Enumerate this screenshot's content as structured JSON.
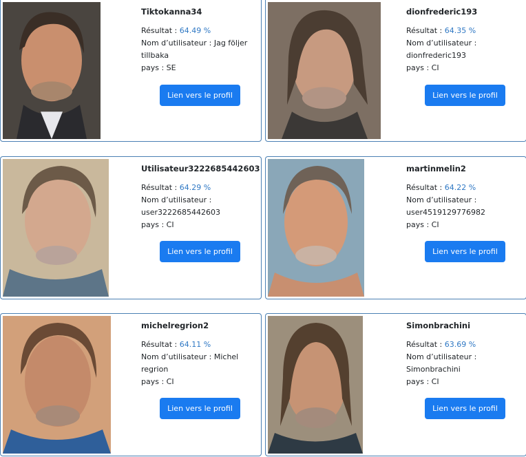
{
  "labels": {
    "result": "Résultat : ",
    "username": "Nom d’utilisateur : ",
    "country": "pays : ",
    "profile_button": "Lien vers le profil"
  },
  "cards": [
    {
      "name": "Tiktokanna34",
      "result": "64.49 %",
      "username_lines": [
        "Nom d’utilisateur : Jag följer",
        "tillbaka"
      ],
      "country": "SE"
    },
    {
      "name": "dionfrederic193",
      "result": "64.35 %",
      "username_lines": [
        "Nom d’utilisateur :",
        "dionfrederic193"
      ],
      "country": "CI"
    },
    {
      "name": "Utilisateur3222685442603",
      "result": "64.29 %",
      "username_lines": [
        "Nom d’utilisateur :",
        "user3222685442603"
      ],
      "country": "CI"
    },
    {
      "name": "martinmelin2",
      "result": "64.22 %",
      "username_lines": [
        "Nom d’utilisateur :",
        "user4519129776982"
      ],
      "country": "CI"
    },
    {
      "name": "michelregrion2",
      "result": "64.11 %",
      "username_lines": [
        "Nom d’utilisateur : Michel",
        "regrion"
      ],
      "country": "CI"
    },
    {
      "name": "Simonbrachini",
      "result": "63.69 %",
      "username_lines": [
        "Nom d’utilisateur :",
        "Simonbrachini"
      ],
      "country": "CI"
    }
  ]
}
